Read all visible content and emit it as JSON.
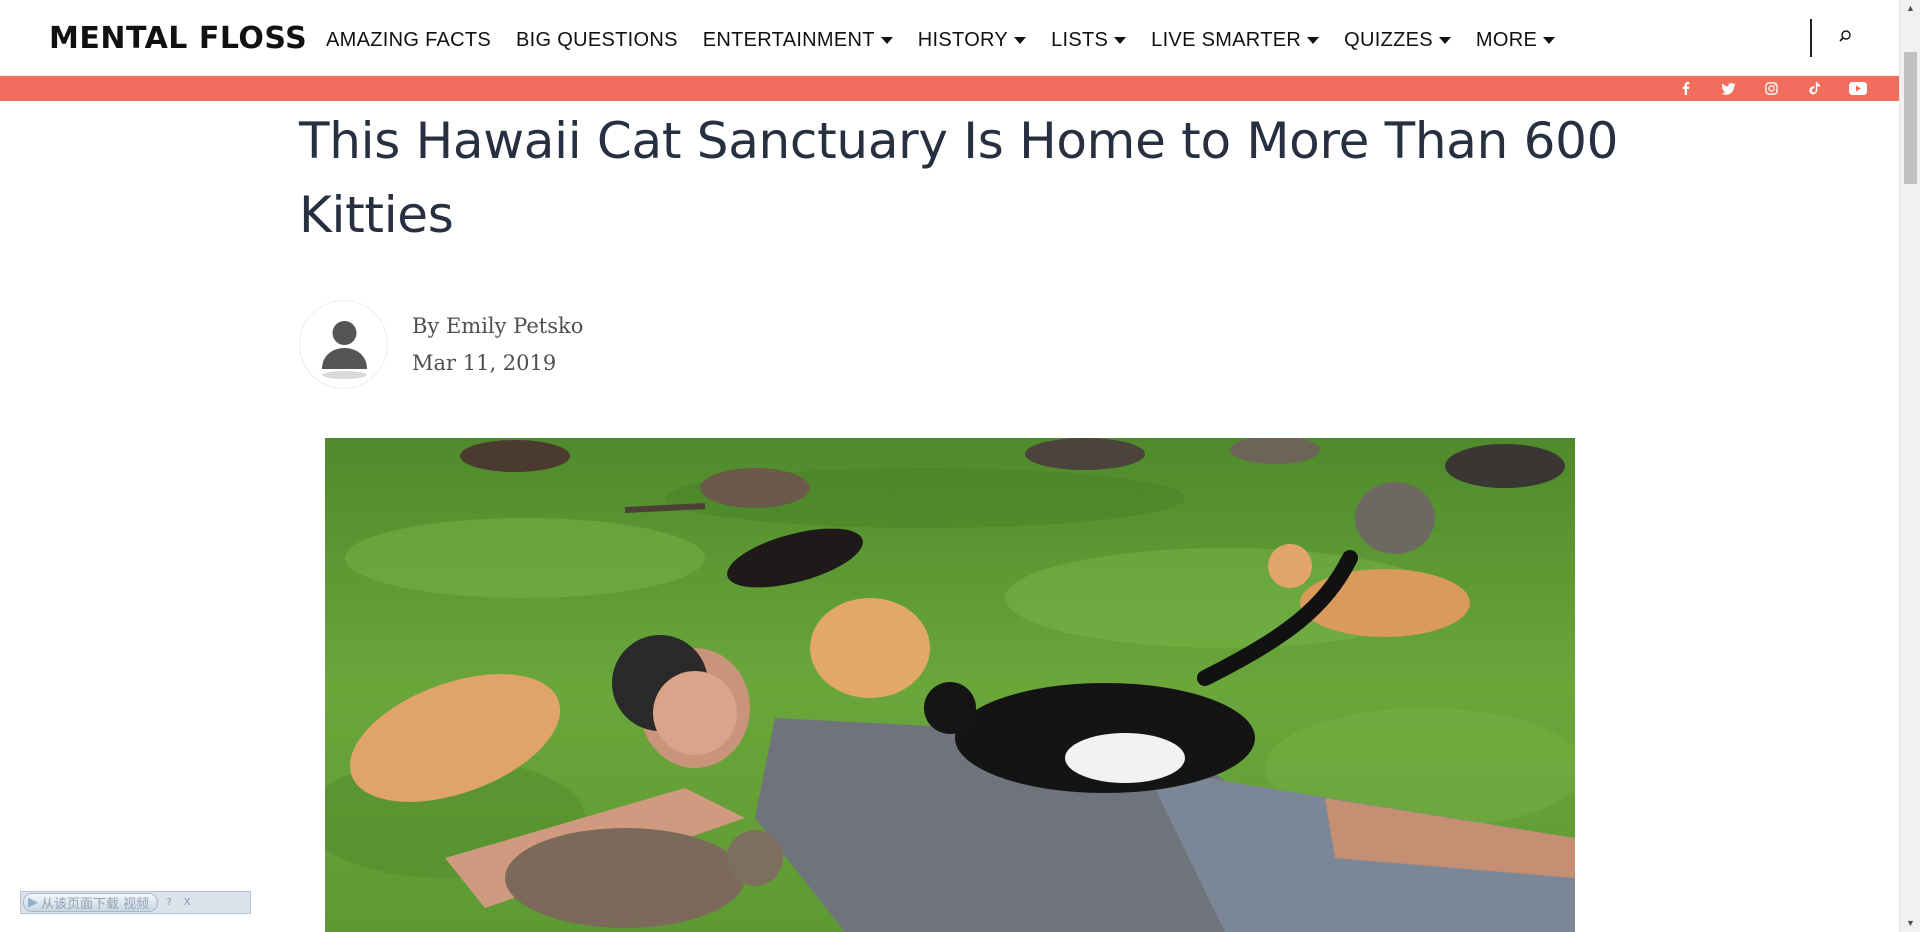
{
  "site": {
    "logo": "MENTAL FLOSS"
  },
  "nav": {
    "items": [
      {
        "label": "AMAZING FACTS",
        "dropdown": false
      },
      {
        "label": "BIG QUESTIONS",
        "dropdown": false
      },
      {
        "label": "ENTERTAINMENT",
        "dropdown": true
      },
      {
        "label": "HISTORY",
        "dropdown": true
      },
      {
        "label": "LISTS",
        "dropdown": true
      },
      {
        "label": "LIVE SMARTER",
        "dropdown": true
      },
      {
        "label": "QUIZZES",
        "dropdown": true
      },
      {
        "label": "MORE",
        "dropdown": true
      }
    ]
  },
  "social": {
    "bar_color": "#f16d5e",
    "icons": [
      "facebook-icon",
      "twitter-icon",
      "instagram-icon",
      "tiktok-icon",
      "youtube-icon"
    ]
  },
  "article": {
    "title": "This Hawaii Cat Sanctuary Is Home to More Than 600 Kitties",
    "byline": "By Emily Petsko",
    "date": "Mar 11, 2019",
    "hero_description": "A man lies on green grass surrounded by many cats"
  },
  "overlay": {
    "download_label": "从该页面下载 视频",
    "help": "?",
    "close": "X"
  },
  "colors": {
    "headline": "#263040",
    "accent": "#f16d5e"
  }
}
